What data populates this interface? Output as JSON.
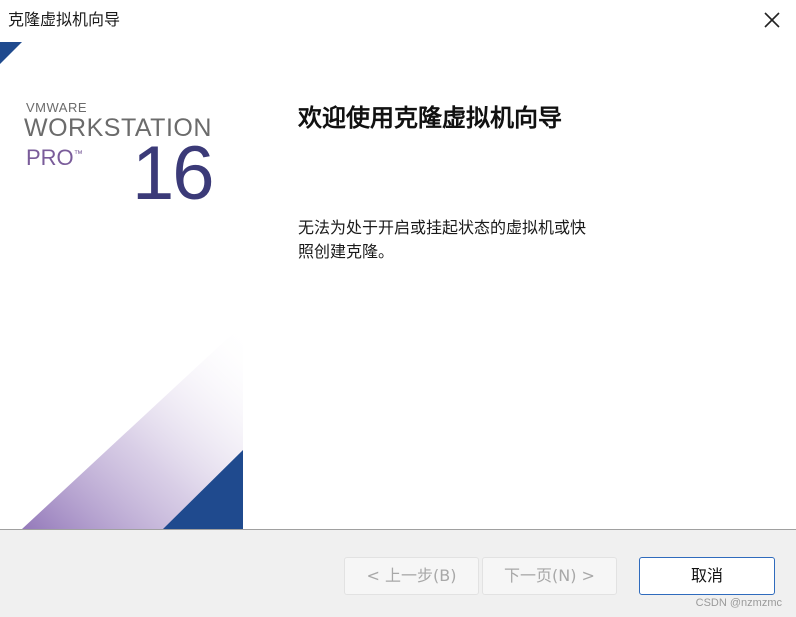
{
  "window": {
    "title": "克隆虚拟机向导"
  },
  "brand": {
    "vendor": "VMWARE",
    "product": "WORKSTATION",
    "edition": "PRO",
    "trademark": "™",
    "version": "16",
    "colors": {
      "navy": "#1f4a8e",
      "purple": "#8e72b6",
      "text_gray": "#6b6b6b",
      "number": "#3b3a78"
    }
  },
  "content": {
    "heading": "欢迎使用克隆虚拟机向导",
    "body_line1": "无法为处于开启或挂起状态的虚拟机或快",
    "body_line2": "照创建克隆。"
  },
  "footer": {
    "back_label": "< 上一步(B)",
    "next_label": "下一页(N) >",
    "cancel_label": "取消",
    "back_enabled": false,
    "next_enabled": false
  },
  "icons": {
    "close": "close-icon"
  },
  "watermark": "CSDN @nzmzmc"
}
